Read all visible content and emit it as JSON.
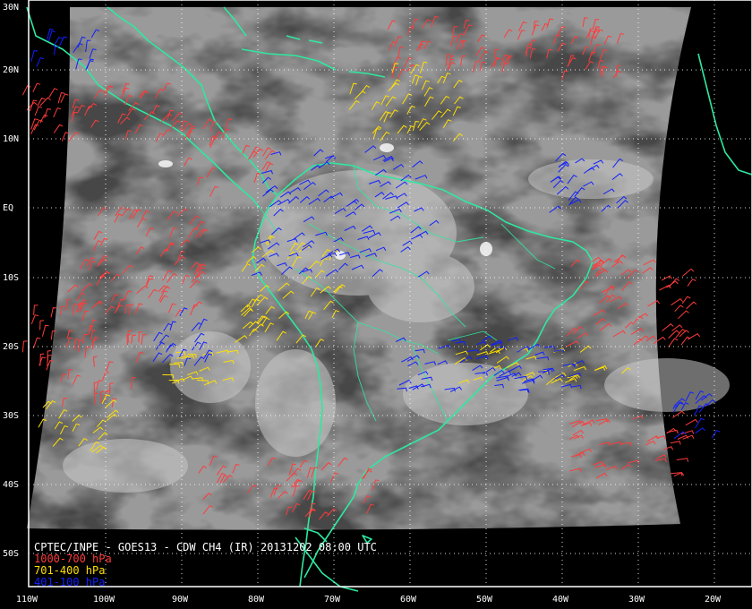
{
  "caption": {
    "title": "CPTEC/INPE - GOES13 - CDW CH4 (IR) 20131202 08:00 UTC"
  },
  "legend": [
    {
      "label": "1000-700 hPa",
      "color": "#ff3b3b"
    },
    {
      "label": "701-400 hPa",
      "color": "#ffe000"
    },
    {
      "label": "401-100 hPa",
      "color": "#1020ff"
    }
  ],
  "lat_labels": [
    "30N",
    "20N",
    "10N",
    "EQ",
    "10S",
    "20S",
    "30S",
    "40S",
    "50S"
  ],
  "lon_labels": [
    "110W",
    "100W",
    "90W",
    "80W",
    "70W",
    "60W",
    "50W",
    "40W",
    "30W",
    "20W"
  ],
  "colors": {
    "background": "#000000",
    "image": "#4a4a4a",
    "coastline": "#2ee8a0",
    "grid": "#ffffff",
    "frame": "#ffffff"
  }
}
